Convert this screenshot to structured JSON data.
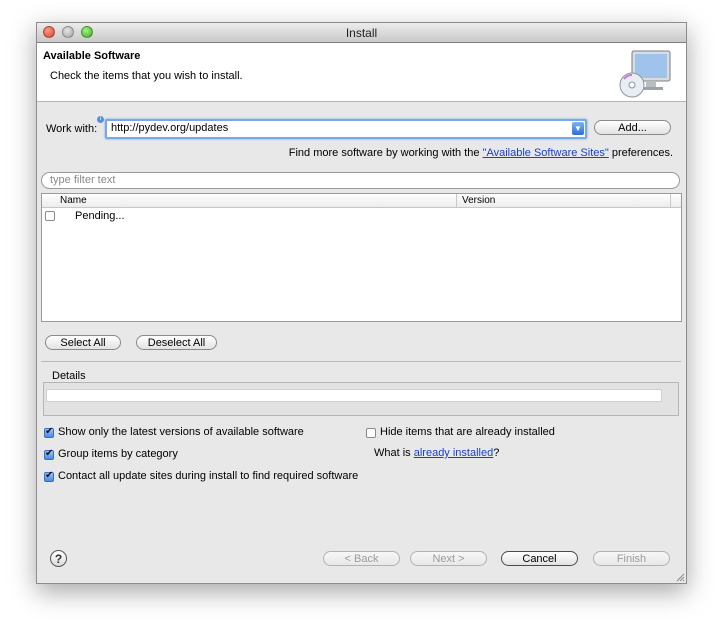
{
  "window": {
    "title": "Install"
  },
  "header": {
    "title": "Available Software",
    "subtitle": "Check the items that you wish to install."
  },
  "work_with": {
    "label": "Work with:",
    "value": "http://pydev.org/updates",
    "add_button": "Add..."
  },
  "find_more": {
    "prefix": "Find more software by working with the ",
    "link": "\"Available Software Sites\"",
    "suffix": " preferences."
  },
  "filter": {
    "placeholder": "type filter text"
  },
  "table": {
    "columns": [
      "Name",
      "Version"
    ],
    "rows": [
      {
        "name": "Pending...",
        "version": "",
        "checked": false
      }
    ]
  },
  "selection_buttons": {
    "select_all": "Select All",
    "deselect_all": "Deselect All"
  },
  "details": {
    "label": "Details"
  },
  "options": {
    "show_latest": {
      "label": "Show only the latest versions of available software",
      "checked": true
    },
    "group_by_category": {
      "label": "Group items by category",
      "checked": true
    },
    "contact_update_sites": {
      "label": "Contact all update sites during install to find required software",
      "checked": true
    },
    "hide_installed": {
      "label": "Hide items that are already installed",
      "checked": false
    },
    "what_is": {
      "prefix": "What is ",
      "link": "already installed",
      "suffix": "?"
    }
  },
  "footer": {
    "help": "?",
    "back": "< Back",
    "next": "Next >",
    "cancel": "Cancel",
    "finish": "Finish"
  },
  "colors": {
    "link": "#1a3fd0",
    "focus_ring": "#7aa7e8",
    "window_bg": "#e8e8e8"
  }
}
